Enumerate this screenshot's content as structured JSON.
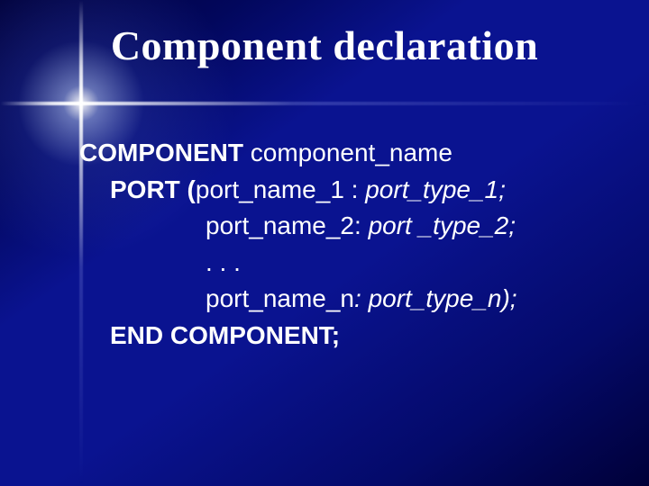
{
  "title": "Component declaration",
  "lines": {
    "l1a": "COMPONENT ",
    "l1b": "component_name",
    "l2a": "PORT (",
    "l2b": "port_name_1 :  ",
    "l2c": "port_type_1;",
    "l3a": "port_name_2:  ",
    "l3b": "port _type_2;",
    "l4": ". . .",
    "l5a": "port_name_n",
    "l5b": ": port_type_n);",
    "l6": "END COMPONENT;"
  }
}
